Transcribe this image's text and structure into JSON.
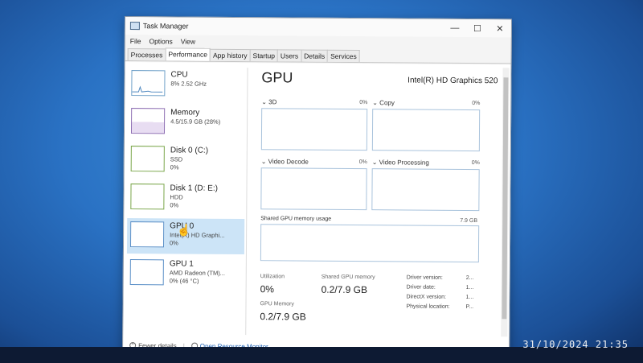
{
  "window": {
    "title": "Task Manager",
    "minimize": "—",
    "maximize": "☐",
    "close": "✕"
  },
  "menu": [
    "File",
    "Options",
    "View"
  ],
  "tabs": [
    "Processes",
    "Performance",
    "App history",
    "Startup",
    "Users",
    "Details",
    "Services"
  ],
  "sidebar": [
    {
      "name": "CPU",
      "sub1": "8% 2.52 GHz",
      "sub2": "",
      "sub3": ""
    },
    {
      "name": "Memory",
      "sub1": "4.5/15.9 GB (28%)",
      "sub2": "",
      "sub3": ""
    },
    {
      "name": "Disk 0 (C:)",
      "sub1": "SSD",
      "sub2": "0%",
      "sub3": ""
    },
    {
      "name": "Disk 1 (D: E:)",
      "sub1": "HDD",
      "sub2": "0%",
      "sub3": ""
    },
    {
      "name": "GPU 0",
      "sub1": "Intel(R) HD Graphi...",
      "sub2": "0%",
      "sub3": ""
    },
    {
      "name": "GPU 1",
      "sub1": "AMD Radeon (TM)...",
      "sub2": "0% (46 °C)",
      "sub3": ""
    }
  ],
  "main": {
    "title": "GPU",
    "model": "Intel(R) HD Graphics 520",
    "graphs": [
      {
        "label": "3D",
        "pct": "0%"
      },
      {
        "label": "Copy",
        "pct": "0%"
      },
      {
        "label": "Video Decode",
        "pct": "0%"
      },
      {
        "label": "Video Processing",
        "pct": "0%"
      }
    ],
    "shared": {
      "label": "Shared GPU memory usage",
      "max": "7.9 GB"
    },
    "stats": {
      "utilization_label": "Utilization",
      "utilization_value": "0%",
      "shared_label": "Shared GPU memory",
      "shared_value": "0.2/7.9 GB",
      "gpu_mem_label": "GPU Memory",
      "gpu_mem_value": "0.2/7.9 GB"
    },
    "details": [
      {
        "key": "Driver version:",
        "value": "2..."
      },
      {
        "key": "Driver date:",
        "value": "1..."
      },
      {
        "key": "DirectX version:",
        "value": "1..."
      },
      {
        "key": "Physical location:",
        "value": "P..."
      }
    ]
  },
  "footer": {
    "fewer": "Fewer details",
    "monitor": "Open Resource Monitor"
  },
  "timestamp": "31/10/2024  21:35"
}
